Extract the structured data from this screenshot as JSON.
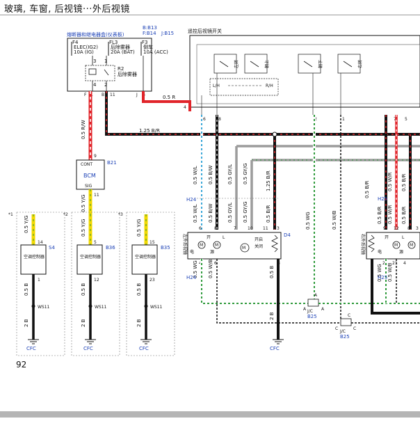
{
  "page": {
    "title": "玻璃, 车窗, 后视镜···外后视镜",
    "number": "92"
  },
  "fuse_box": {
    "heading": "熔断器和继电器盒(仪表板)",
    "connector_codes": [
      "B:B13",
      "F:B14",
      "J:B15"
    ],
    "fuses": [
      {
        "id": "F4",
        "name": "ELEC(IG2)",
        "rating": "10A (IG)"
      },
      {
        "id": "FL3",
        "name": "后除雾器",
        "rating": "20A (BAT)"
      },
      {
        "id": "F3",
        "name": "倒车",
        "rating": "10A (ACC)"
      }
    ],
    "relay": {
      "id": "R2",
      "name": "后除雾器"
    },
    "pins_top": [
      "3",
      "1"
    ],
    "pins_mid": [
      "4",
      "2"
    ],
    "bottom_pins": [
      {
        "conn": "F",
        "pin": "1"
      },
      {
        "conn": "B",
        "pin": "11"
      },
      {
        "conn": "J",
        "pin": "6"
      }
    ]
  },
  "mirror_switch": {
    "heading": "遥控后视镜开关",
    "pin4": "4",
    "lh_label": "L/H",
    "rh_label": "R/H",
    "switch_labels": [
      "左转",
      "朝上",
      "朝下",
      "右转"
    ],
    "bottom_pins": [
      "6",
      "8",
      "2",
      "1",
      "7",
      "5"
    ]
  },
  "bcm": {
    "name": "BCM",
    "code": "B21",
    "top_label": "CONT",
    "bottom_label": "SIG",
    "pin_top": "9",
    "pin_bottom": "11"
  },
  "wires": {
    "main_red": "0.5 R",
    "main_black": "1.25 B/R",
    "rw": "0.5 R/W",
    "yg_bcm": "0.5 Y/G",
    "left_down": [
      "0.5 W/L",
      "0.5 B/W",
      "0.5 GY/L",
      "0.5 GY/G",
      "1.25 B/R"
    ],
    "left_down_lower": [
      "0.5 W/L",
      "0.5 B/W",
      "0.5 GY/L",
      "0.5 GY/G",
      "0.5 B/R"
    ],
    "wg_long": "0.5 WG",
    "wb_long": "0.5 W/B",
    "right_down": [
      "0.5 B/R",
      "0.5 W/R",
      "0.5 B/R"
    ],
    "right_down_lower": [
      "0.5 B/R",
      "0.5 W/R",
      "0.5 B/R"
    ],
    "ac_wire": "0.5 Y/G",
    "ac_b": "0.5 B",
    "ac_2b": "2 B",
    "mirror_lower_left": [
      "0.5 WG",
      "0.5 W/B"
    ],
    "mirror_lower_right": [
      "0.5 WG",
      "0.5 W/B"
    ],
    "d4_ground_b": "0.5 B",
    "d4_ground_2b": "2 B"
  },
  "connectors": {
    "h24": "H24",
    "h25": "H25",
    "d4": "D4",
    "b25": "B25",
    "jc": "J/C",
    "ws11": "WS11",
    "cfc": "CFC"
  },
  "left_mirror": {
    "name": "左外后视镜",
    "motor_labels": [
      "开",
      "L"
    ],
    "heater_labels": [
      "开启",
      "关闭"
    ],
    "top_pins": [
      "6",
      "8",
      "7",
      "10",
      "11",
      "3"
    ],
    "bottom_pins": [
      "4",
      "6",
      "8"
    ],
    "side_labels": [
      "电",
      "源"
    ]
  },
  "right_mirror": {
    "name": "右外后视镜",
    "motor_labels": [
      "开",
      "L"
    ],
    "top_pins": [
      "9",
      "12",
      "8",
      "3"
    ],
    "bottom_pins": [
      "2",
      "21",
      "4"
    ],
    "side_labels": [
      "电",
      "源"
    ]
  },
  "ac_controllers": [
    {
      "mark": "*1",
      "name": "空调控制器",
      "code": "S4",
      "pin_top": "14",
      "pin_bottom": "1"
    },
    {
      "mark": "*2",
      "name": "空调控制器",
      "code": "B36",
      "pin_top": "5",
      "pin_bottom": "12"
    },
    {
      "mark": "*3",
      "name": "空调控制器",
      "code": "B35",
      "pin_top": "15",
      "pin_bottom": "23"
    }
  ],
  "jc_pins": {
    "a": "A",
    "c": "C"
  },
  "colors": {
    "red": "#e1242a",
    "black": "#111111",
    "yellow": "#f2d800",
    "blue_text": "#1a3fb5",
    "grey_wire": "#9c9c9c",
    "cyan": "#3aa7d8",
    "green": "#2e9a3b"
  }
}
